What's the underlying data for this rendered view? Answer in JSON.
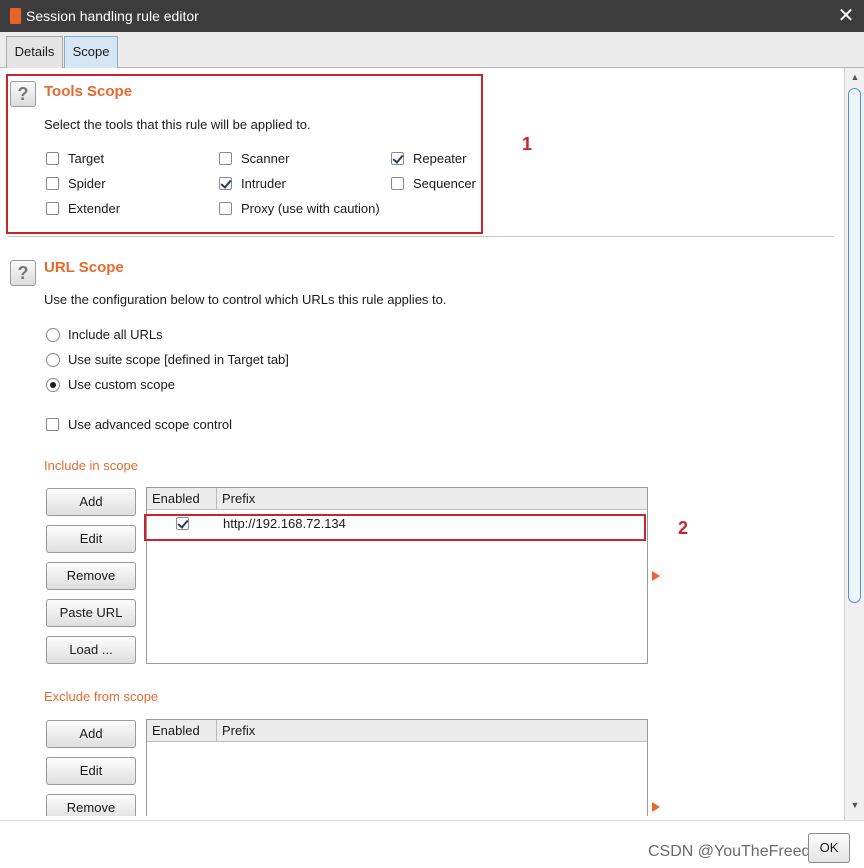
{
  "window": {
    "title": "Session handling rule editor"
  },
  "tabs": [
    {
      "label": "Details"
    },
    {
      "label": "Scope"
    }
  ],
  "tools_scope": {
    "title": "Tools Scope",
    "description": "Select the tools that this rule will be applied to.",
    "tools": [
      {
        "label": "Target",
        "checked": false
      },
      {
        "label": "Spider",
        "checked": false
      },
      {
        "label": "Extender",
        "checked": false
      },
      {
        "label": "Scanner",
        "checked": false
      },
      {
        "label": "Intruder",
        "checked": true
      },
      {
        "label": "Proxy (use with caution)",
        "checked": false
      },
      {
        "label": "Repeater",
        "checked": true
      },
      {
        "label": "Sequencer",
        "checked": false
      }
    ]
  },
  "url_scope": {
    "title": "URL Scope",
    "description": "Use the configuration below to control which URLs this rule applies to.",
    "options": [
      {
        "label": "Include all URLs",
        "selected": false
      },
      {
        "label": "Use suite scope [defined in Target tab]",
        "selected": false
      },
      {
        "label": "Use custom scope",
        "selected": true
      }
    ],
    "advanced": {
      "label": "Use advanced scope control",
      "checked": false
    }
  },
  "include_scope": {
    "title": "Include in scope",
    "buttons": [
      "Add",
      "Edit",
      "Remove",
      "Paste URL",
      "Load ..."
    ],
    "columns": [
      "Enabled",
      "Prefix"
    ],
    "rows": [
      {
        "enabled": true,
        "prefix": "http://192.168.72.134"
      }
    ]
  },
  "exclude_scope": {
    "title": "Exclude from scope",
    "buttons": [
      "Add",
      "Edit",
      "Remove"
    ],
    "columns": [
      "Enabled",
      "Prefix"
    ],
    "rows": []
  },
  "annotations": [
    "1",
    "2"
  ],
  "footer": {
    "ok_label": "OK",
    "watermark": "CSDN @YouTheFreedom"
  },
  "colors": {
    "accent": "#e8692e",
    "annotation": "#c8242f",
    "titlebar": "#3c3c3c"
  }
}
